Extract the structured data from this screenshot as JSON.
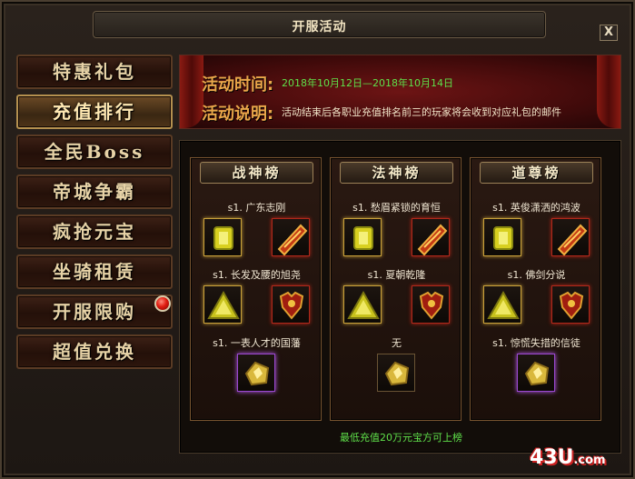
{
  "window": {
    "title": "开服活动",
    "close_label": "X"
  },
  "menu": {
    "items": [
      {
        "label": "特惠礼包",
        "active": false
      },
      {
        "label": "充值排行",
        "active": true
      },
      {
        "label": "全民Boss",
        "active": false
      },
      {
        "label": "帝城争霸",
        "active": false
      },
      {
        "label": "疯抢元宝",
        "active": false
      },
      {
        "label": "坐骑租赁",
        "active": false
      },
      {
        "label": "开服限购",
        "active": false,
        "badge": true
      },
      {
        "label": "超值兑换",
        "active": false
      }
    ]
  },
  "banner": {
    "time_label": "活动时间:",
    "time_value": "2018年10月12日—2018年10月14日",
    "desc_label": "活动说明:",
    "desc_value": "活动结束后各职业充值排名前三的玩家将会收到对应礼包的邮件"
  },
  "ranking": {
    "columns": [
      {
        "title": "战神榜",
        "ranks": [
          "s1. 广东志刚",
          "s1. 长发及腰的旭尧",
          "s1. 一表人才的国藩"
        ]
      },
      {
        "title": "法神榜",
        "ranks": [
          "s1. 愁眉紧锁的育恒",
          "s1. 夏朝乾隆",
          "无"
        ]
      },
      {
        "title": "道尊榜",
        "ranks": [
          "s1. 英俊潇洒的鸿波",
          "s1. 佛剑分说",
          "s1. 惊慌失措的信徒"
        ]
      }
    ],
    "footer_note": "最低充值20万元宝方可上榜"
  },
  "watermark": {
    "text": "43U",
    "suffix": ".com"
  },
  "colors": {
    "accent_green": "#5fe04a",
    "label_orange": "#e9a64a",
    "banner_red": "#6d1414"
  }
}
